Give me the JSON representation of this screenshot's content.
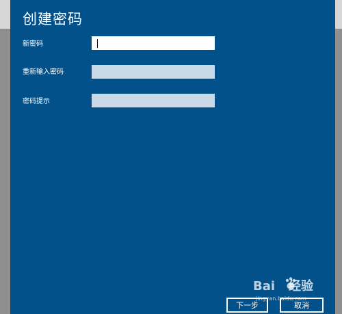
{
  "dialog": {
    "title": "创建密码",
    "fields": [
      {
        "label": "新密码",
        "value": "",
        "state": "active"
      },
      {
        "label": "重新输入密码",
        "value": "",
        "state": "inactive"
      },
      {
        "label": "密码提示",
        "value": "",
        "state": "inactive"
      }
    ],
    "buttons": {
      "next": "下一步",
      "cancel": "取消"
    }
  },
  "watermark": {
    "brand": "Bai",
    "brand_suffix": "经验",
    "url": "jingyan.baidu.com"
  },
  "colors": {
    "dialog_bg": "#02518a",
    "input_active": "#ffffff",
    "input_inactive": "#c9d9e8",
    "backdrop": "#8f8f8f"
  }
}
